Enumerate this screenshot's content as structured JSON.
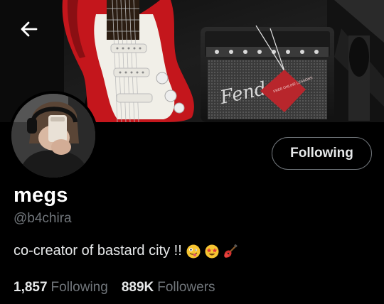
{
  "header": {
    "back_icon": "arrow-left-icon"
  },
  "banner": {
    "description_icons": [
      "guitar",
      "amplifier"
    ],
    "amp_brand": "Fender",
    "tag_text": "FREE ONLINE LESSONS"
  },
  "profile": {
    "display_name": "megs",
    "handle": "@b4chira",
    "bio_text": "co-creator of bastard city !!",
    "bio_emojis": [
      "zany-face-emoji",
      "star-struck-face-emoji",
      "guitar-emoji"
    ],
    "follow_button_label": "Following",
    "following_count": "1,857",
    "following_label": "Following",
    "followers_count": "889K",
    "followers_label": "Followers"
  },
  "colors": {
    "background": "#000000",
    "primary_text": "#e7e9ea",
    "secondary_text": "#71767b",
    "button_border": "#71767b",
    "guitar_body": "#c4161c"
  }
}
